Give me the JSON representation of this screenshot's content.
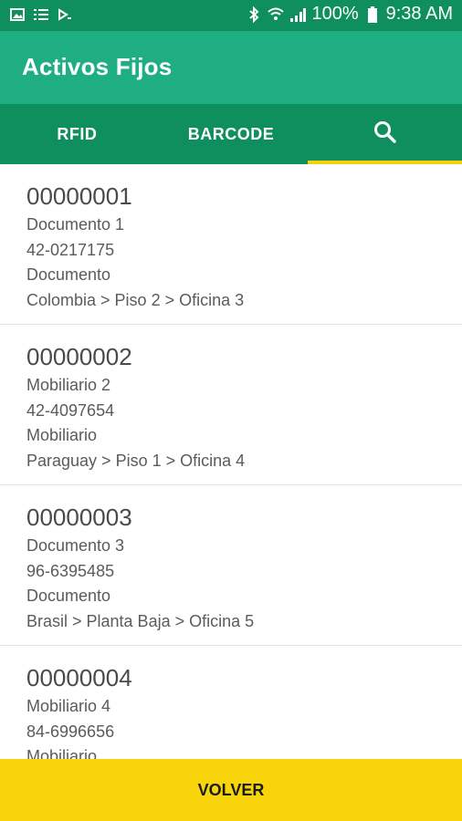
{
  "status": {
    "battery": "100%",
    "time": "9:38 AM",
    "icons": [
      "image-icon",
      "list-icon",
      "cast-icon",
      "bluetooth-icon",
      "wifi-icon",
      "signal-icon",
      "battery-icon"
    ]
  },
  "appbar": {
    "title": "Activos Fijos"
  },
  "tabs": [
    {
      "label": "RFID"
    },
    {
      "label": "BARCODE"
    },
    {
      "label": "",
      "icon": "search-icon",
      "active": true
    }
  ],
  "items": [
    {
      "code": "00000001",
      "name": "Documento 1",
      "ref": "42-0217175",
      "type": "Documento",
      "location": "Colombia > Piso 2 > Oficina 3"
    },
    {
      "code": "00000002",
      "name": "Mobiliario 2",
      "ref": "42-4097654",
      "type": "Mobiliario",
      "location": "Paraguay > Piso 1 > Oficina 4"
    },
    {
      "code": "00000003",
      "name": "Documento 3",
      "ref": "96-6395485",
      "type": "Documento",
      "location": "Brasil > Planta Baja > Oficina 5"
    },
    {
      "code": "00000004",
      "name": "Mobiliario 4",
      "ref": "84-6996656",
      "type": "Mobiliario",
      "location": ""
    }
  ],
  "footer": {
    "label": "VOLVER"
  },
  "colors": {
    "statusbar": "#0f8e5e",
    "appbar": "#1fae81",
    "accent": "#f3d10b",
    "footer": "#f8d40b"
  }
}
